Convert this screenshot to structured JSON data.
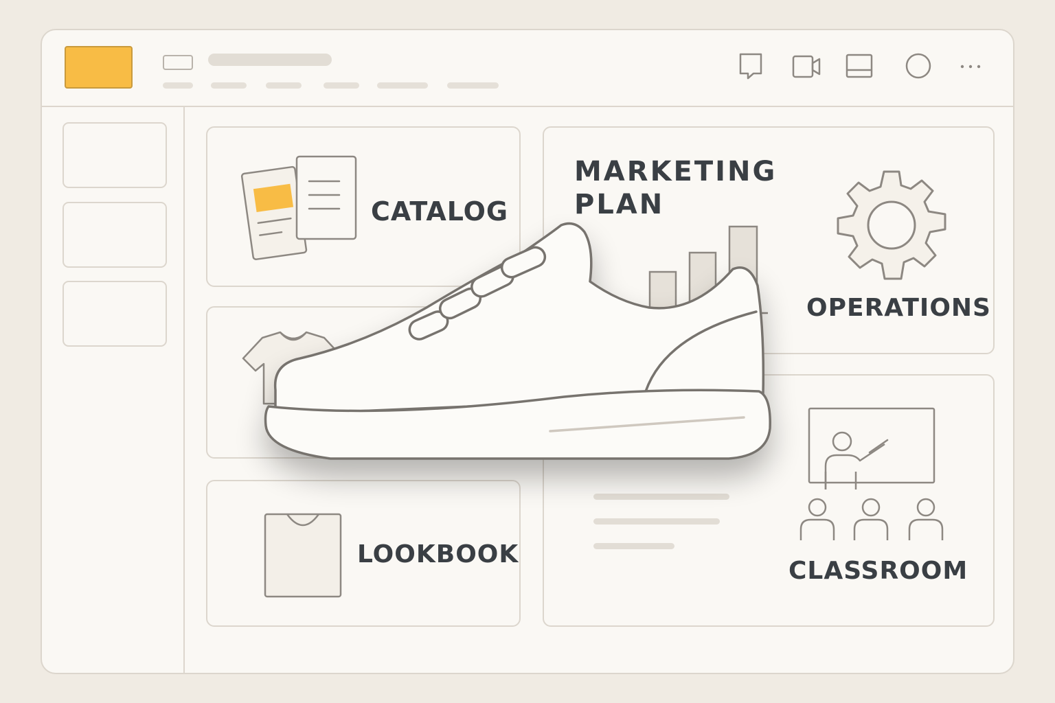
{
  "toolbar": {
    "icons": [
      "chat-icon",
      "video-camera-icon",
      "layout-panel-icon",
      "profile-circle-icon",
      "more-options-icon"
    ]
  },
  "cards": {
    "catalog": {
      "label": "CATALOG",
      "icon": "documents-icon"
    },
    "marketing_plan": {
      "label_line1": "MARKETING",
      "label_line2": "PLAN",
      "icon": "bar-chart-icon"
    },
    "operations": {
      "label": "OPERATIONS",
      "icon": "gear-icon"
    },
    "apparel": {
      "icon": "t-shirt-icon"
    },
    "lookbook": {
      "label": "LOOKBOOK",
      "icon": "lookbook-shirt-icon"
    },
    "classroom": {
      "label": "CLASSROOM",
      "icon": "presentation-board-icon"
    }
  },
  "hero": {
    "icon": "sneaker-icon"
  },
  "colors": {
    "accent": "#f8bc45",
    "text": "#3a3f44",
    "line": "#77736e",
    "background": "#f0ebe3"
  }
}
